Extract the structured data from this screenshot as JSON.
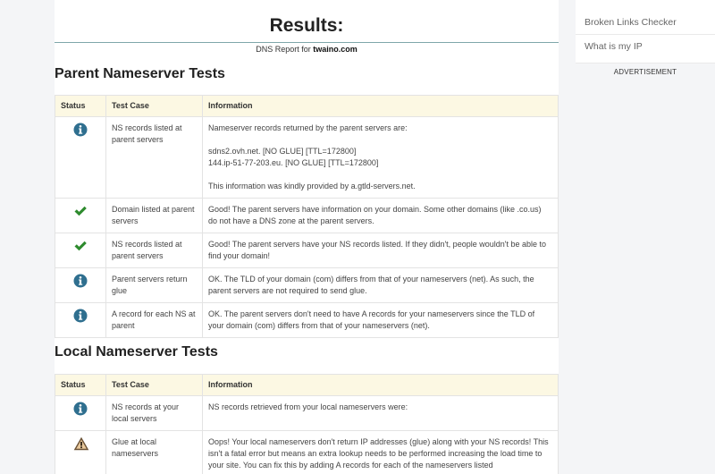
{
  "header": {
    "title": "Results:",
    "report_prefix": "DNS Report for ",
    "domain": "twaino.com"
  },
  "parent_section": {
    "title": "Parent Nameserver Tests",
    "columns": [
      "Status",
      "Test Case",
      "Information"
    ],
    "rows": [
      {
        "status": "info",
        "test_case": "NS records listed at parent servers",
        "info": [
          "Nameserver records returned by the parent servers are:",
          "sdns2.ovh.net. [NO GLUE] [TTL=172800]",
          "144.ip-51-77-203.eu. [NO GLUE] [TTL=172800]",
          "This information was kindly provided by a.gtld-servers.net."
        ]
      },
      {
        "status": "pass",
        "test_case": "Domain listed at parent servers",
        "info": [
          "Good! The parent servers have information on your domain. Some other domains (like .co.us) do not have a DNS zone at the parent servers."
        ]
      },
      {
        "status": "pass",
        "test_case": "NS records listed at parent servers",
        "info": [
          "Good! The parent servers have your NS records listed. If they didn't, people wouldn't be able to find your domain!"
        ]
      },
      {
        "status": "info",
        "test_case": "Parent servers return glue",
        "info": [
          "OK. The TLD of your domain (com) differs from that of your nameservers (net). As such, the parent servers are not required to send glue."
        ]
      },
      {
        "status": "info",
        "test_case": "A record for each NS at parent",
        "info": [
          "OK. The parent servers don't need to have A records for your nameservers since the TLD of your domain (com) differs from that of your nameservers (net)."
        ]
      }
    ]
  },
  "local_section": {
    "title": "Local Nameserver Tests",
    "columns": [
      "Status",
      "Test Case",
      "Information"
    ],
    "rows": [
      {
        "status": "info",
        "test_case": "NS records at your local servers",
        "info": [
          "NS records retrieved from your local nameservers were:"
        ]
      },
      {
        "status": "warning",
        "test_case": "Glue at local nameservers",
        "info": [
          "Oops! Your local nameservers don't return IP addresses (glue) along with your NS records! This isn't a fatal error but means an extra lookup needs to be performed increasing the load time to your site. You can fix this by adding A records for each of the nameservers listed"
        ]
      }
    ]
  },
  "sidebar": {
    "items": [
      "Broken Links Checker",
      "What is my IP"
    ],
    "ad_label": "ADVERTISEMENT"
  },
  "icons": {
    "info": "info-circle-icon",
    "pass": "check-mark-icon",
    "warning": "warning-triangle-icon"
  },
  "colors": {
    "info": "#2f6f8f",
    "pass": "#2e8b2e",
    "warning": "#6b5236",
    "table_header": "#fcf8e3",
    "divider": "#7fa7ab"
  }
}
